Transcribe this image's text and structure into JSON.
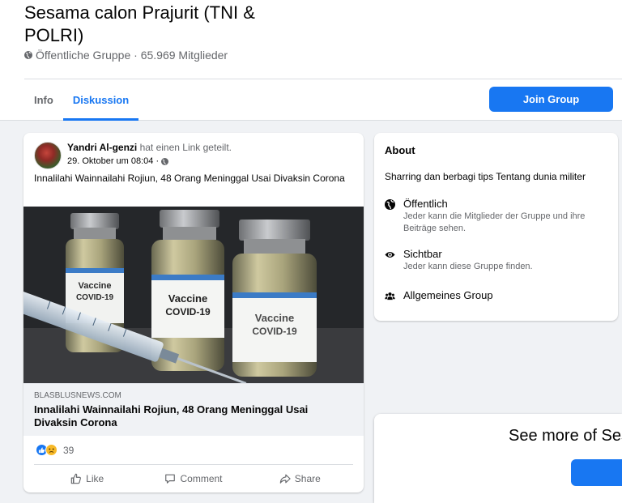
{
  "group": {
    "title": "Sesama calon Prajurit (TNI & POLRI)",
    "meta": "Öffentliche Gruppe · 65.969 Mitglieder",
    "meta_icon": "globe-icon"
  },
  "tabs": [
    {
      "label": "Info",
      "active": false
    },
    {
      "label": "Diskussion",
      "active": true
    }
  ],
  "join_button": {
    "label": "Join Group"
  },
  "colors": {
    "accent": "#1877f2",
    "background": "#f0f2f5",
    "muted_text": "#65676b"
  },
  "post": {
    "author": "Yandri Al-genzi",
    "action": "hat einen Link geteilt.",
    "timestamp": "29. Oktober um 08:04 ·",
    "text": "Innalilahi Wainnailahi Rojiun, 48 Orang Meninggal Usai Divaksin Corona",
    "image": {
      "vial_labels": [
        {
          "line1": "Vaccine",
          "line2": "COVID-19"
        },
        {
          "line1": "Vaccine",
          "line2": "COVID-19"
        },
        {
          "line1": "Vaccine",
          "line2": "COVID-19"
        }
      ]
    },
    "link": {
      "domain": "BLASBLUSNEWS.COM",
      "title": "Innalilahi Wainnailahi Rojiun, 48 Orang Meninggal Usai Divaksin Corona"
    },
    "reactions": {
      "icons": [
        "like-icon",
        "sad-icon"
      ],
      "count": "39"
    },
    "actions": [
      {
        "label": "Like",
        "icon": "thumbs-up-icon"
      },
      {
        "label": "Comment",
        "icon": "comment-icon"
      },
      {
        "label": "Share",
        "icon": "share-icon"
      }
    ]
  },
  "about": {
    "heading": "About",
    "description": "Sharring dan berbagi tips Tentang dunia militer",
    "items": [
      {
        "icon": "globe-icon",
        "title": "Öffentlich",
        "subtitle": "Jeder kann die Mitglieder der Gruppe und ihre Beiträge sehen."
      },
      {
        "icon": "eye-icon",
        "title": "Sichtbar",
        "subtitle": "Jeder kann diese Gruppe finden."
      },
      {
        "icon": "people-icon",
        "title": "Allgemeines Group",
        "subtitle": ""
      }
    ]
  },
  "see_more": {
    "text": "See more of Ses"
  }
}
